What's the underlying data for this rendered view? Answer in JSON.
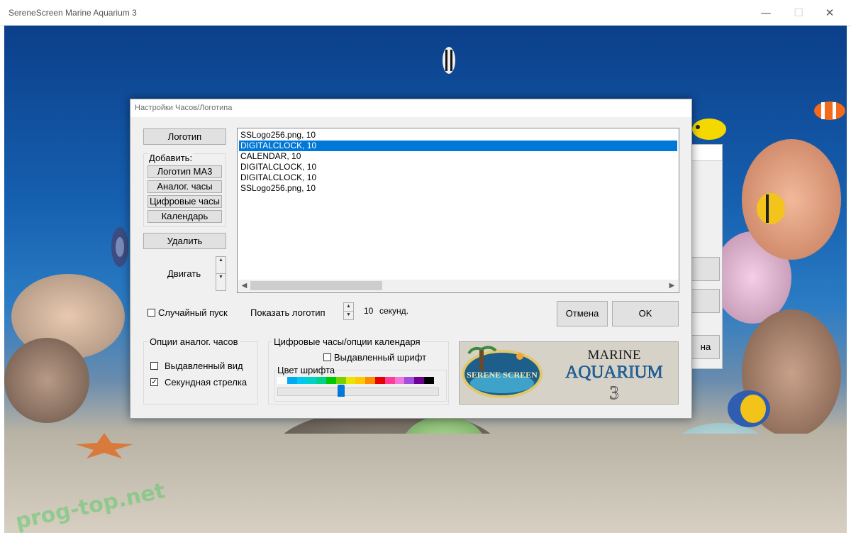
{
  "window": {
    "title": "SereneScreen Marine Aquarium 3",
    "min_glyph": "—",
    "max_glyph": "☐",
    "close_glyph": "✕"
  },
  "watermark": "prog-top.net",
  "dialog": {
    "title": "Настройки Часов/Логотипа",
    "logo_button": "Логотип",
    "add_group_label": "Добавить:",
    "add_buttons": [
      "Логотип MA3",
      "Аналог. часы",
      "Цифровые часы",
      "Календарь"
    ],
    "delete_button": "Удалить",
    "move_label": "Двигать",
    "list_items": [
      "SSLogo256.png, 10",
      "DIGITALCLOCK, 10",
      "CALENDAR, 10",
      "DIGITALCLOCK, 10",
      "DIGITALCLOCK, 10",
      "SSLogo256.png, 10"
    ],
    "selected_index": 1,
    "random_start_label": "Случайный пуск",
    "random_start_checked": false,
    "show_logo_label": "Показать логотип",
    "show_logo_seconds": "10",
    "seconds_label": "секунд.",
    "cancel_button": "Отмена",
    "ok_button": "OK",
    "analog_group": {
      "title": "Опции аналог. часов",
      "embossed_label": "Выдавленный вид",
      "embossed_checked": false,
      "second_hand_label": "Секундная стрелка",
      "second_hand_checked": true
    },
    "digital_group": {
      "title": "Цифровые часы/опции календаря",
      "embossed_font_label": "Выдавленный шрифт",
      "embossed_font_checked": false,
      "font_color_label": "Цвет шрифта",
      "palette": [
        "#ffffff",
        "#00aaee",
        "#00c8f0",
        "#00d2c8",
        "#00d28c",
        "#00c800",
        "#78d200",
        "#e6e600",
        "#ffc800",
        "#ff8c00",
        "#e60000",
        "#ff3c96",
        "#f078dc",
        "#a050dc",
        "#6e0096",
        "#000000"
      ],
      "slider_value_index": 6
    },
    "logo_image": {
      "brand": "SERENE SCREEN",
      "product_line1": "MARINE",
      "product_line2": "AQUARIUM",
      "version": "3"
    }
  },
  "background_dialog": {
    "button_partial": "на"
  }
}
